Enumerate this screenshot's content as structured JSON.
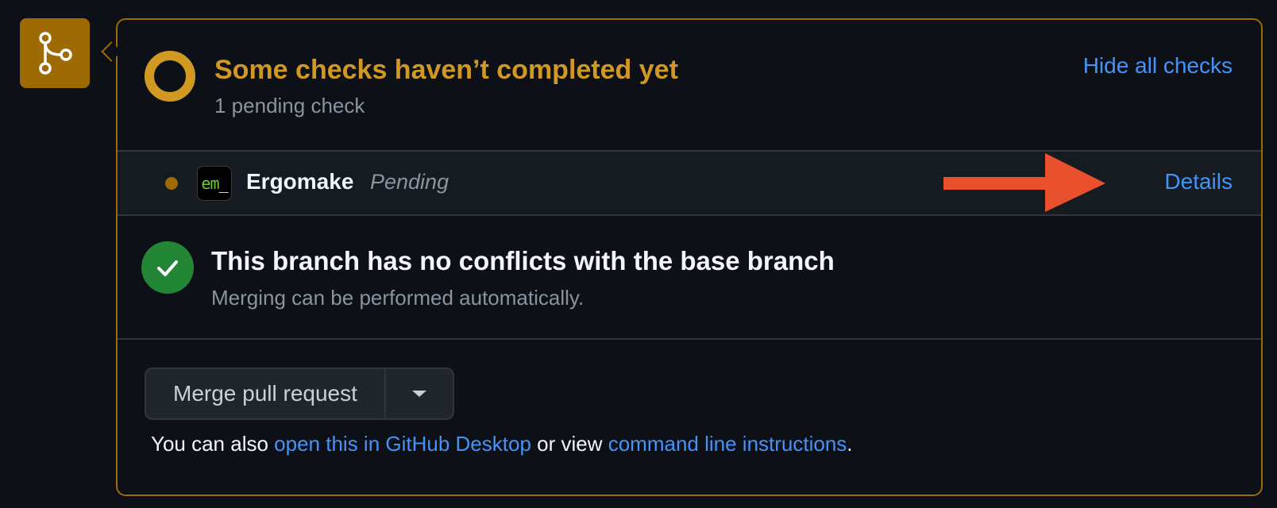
{
  "badge": {
    "icon": "git-merge-icon",
    "color": "#9e6a03"
  },
  "checks": {
    "title": "Some checks haven’t completed yet",
    "subtitle": "1 pending check",
    "hide_link": "Hide all checks",
    "status_color": "#d29922",
    "items": [
      {
        "app_icon_text_prefix": "em",
        "app_icon_text_suffix": "_",
        "name": "Ergomake",
        "status": "Pending",
        "details_link": "Details"
      }
    ]
  },
  "conflicts": {
    "title": "This branch has no conflicts with the base branch",
    "subtitle": "Merging can be performed automatically.",
    "icon": "check-icon",
    "color": "#238636"
  },
  "merge": {
    "button_label": "Merge pull request",
    "dropdown_icon": "triangle-down-icon",
    "note_prefix": "You can also ",
    "desktop_link": "open this in GitHub Desktop",
    "note_middle": " or view ",
    "cli_link": "command line instructions",
    "note_suffix": "."
  },
  "annotation": {
    "arrow_color": "#e9502d"
  }
}
